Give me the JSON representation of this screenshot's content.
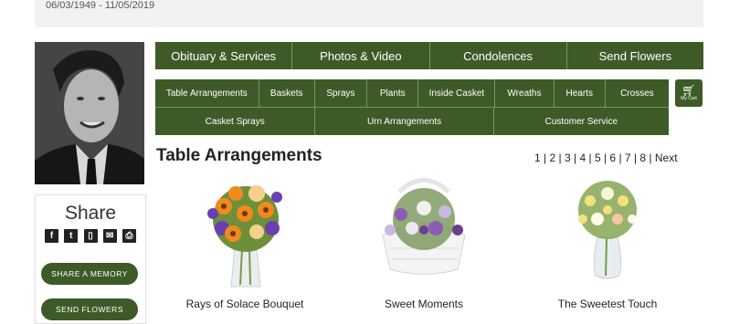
{
  "header": {
    "dates": "06/03/1949 - 11/05/2019"
  },
  "share": {
    "title": "Share",
    "icons": [
      "facebook-icon",
      "twitter-icon",
      "mobile-icon",
      "email-icon",
      "print-icon"
    ],
    "buttons": {
      "memory": "SHARE A MEMORY",
      "flowers": "SEND FLOWERS"
    }
  },
  "nav_main": [
    "Obituary & Services",
    "Photos & Video",
    "Condolences",
    "Send Flowers"
  ],
  "nav_categories_row1": [
    "Table Arrangements",
    "Baskets",
    "Sprays",
    "Plants",
    "Inside Casket",
    "Wreaths",
    "Hearts",
    "Crosses"
  ],
  "nav_categories_row2": [
    "Casket Sprays",
    "Urn Arrangements",
    "Customer Service"
  ],
  "cart": {
    "label": "My Cart"
  },
  "section": {
    "title": "Table Arrangements"
  },
  "pagination": [
    "1",
    "2",
    "3",
    "4",
    "5",
    "6",
    "7",
    "8",
    "Next"
  ],
  "products": [
    {
      "name": "Rays of Solace Bouquet"
    },
    {
      "name": "Sweet Moments"
    },
    {
      "name": "The Sweetest Touch"
    }
  ],
  "colors": {
    "brand_green": "#3e5b27",
    "divider": "#7c9266"
  }
}
